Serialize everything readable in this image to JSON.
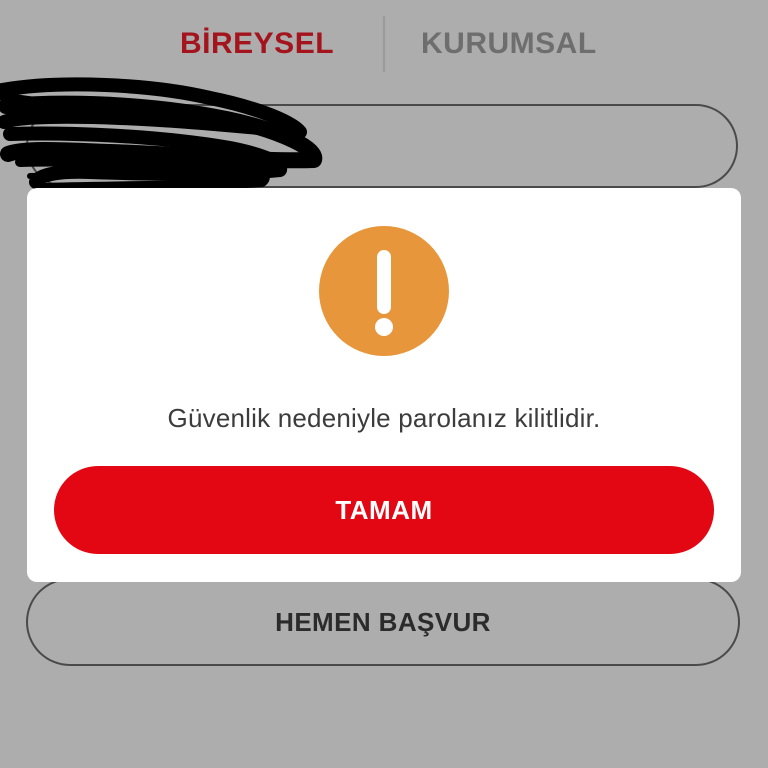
{
  "tabs": {
    "individual_label": "BİREYSEL",
    "corporate_label": "KURUMSAL",
    "active": "BİREYSEL"
  },
  "dialog": {
    "icon": "exclamation-icon",
    "message": "Güvenlik nedeniyle parolanız kilitlidir.",
    "ok_label": "TAMAM"
  },
  "background": {
    "apply_label": "HEMEN BAŞVUR",
    "redacted_field": "redacted-scribble"
  },
  "colors": {
    "brand_red": "#e30613",
    "active_tab": "#a3141c",
    "inactive_tab": "#6e6e6e",
    "warning_orange": "#e8963b",
    "overlay_gray": "#adadad",
    "modal_bg": "#ffffff"
  }
}
